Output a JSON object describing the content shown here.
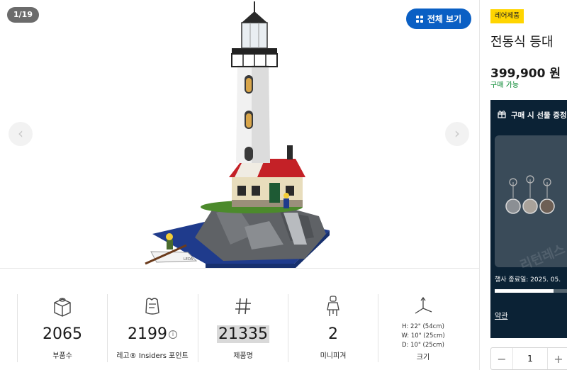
{
  "gallery": {
    "counter": "1/19",
    "view_all_label": "전체 보기",
    "prev_arrow": "‹",
    "next_arrow": "›",
    "image_caption": "LEDA"
  },
  "specs": [
    {
      "icon": "brick-icon",
      "value": "2065",
      "label": "부품수"
    },
    {
      "icon": "insiders-icon",
      "value": "2199",
      "info": "i",
      "label": "레고® Insiders 포인트"
    },
    {
      "icon": "hash-icon",
      "value": "21335",
      "label": "제품명"
    },
    {
      "icon": "minifigure-icon",
      "value": "2",
      "label": "미니피겨"
    },
    {
      "icon": "dimensions-icon",
      "dims": [
        "H: 22\" (54cm)",
        "W: 10\" (25cm)",
        "D: 10\" (25cm)"
      ],
      "label": "크기"
    }
  ],
  "panel": {
    "badge": "레어제품",
    "name": "전동식 등대",
    "price": "399,900 원",
    "availability": "구매 가능",
    "gift": {
      "title": "구매 시 선물 증정",
      "end_date": "행사 종료일: 2025. 05.",
      "progress": 0.8,
      "terms": "약관",
      "watermark": "리턴레스"
    },
    "quantity": {
      "minus": "−",
      "value": "1",
      "plus": "+"
    }
  },
  "colors": {
    "view_all_bg": "#0a5fc4",
    "badge_bg": "#ffd500",
    "availability": "#00852b",
    "gift_bg": "#0b2235"
  }
}
